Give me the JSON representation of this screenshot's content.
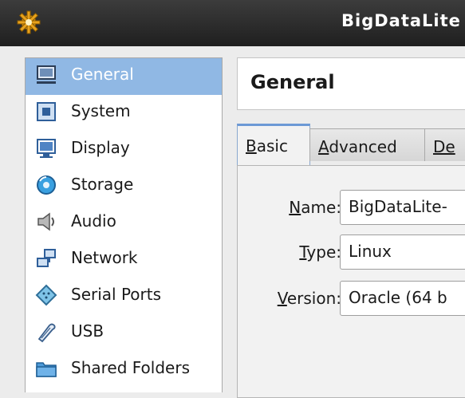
{
  "window": {
    "title": "BigDataLite"
  },
  "sidebar": {
    "items": [
      {
        "label": "General",
        "icon": "monitor-icon",
        "selected": true
      },
      {
        "label": "System",
        "icon": "chip-icon"
      },
      {
        "label": "Display",
        "icon": "display-icon"
      },
      {
        "label": "Storage",
        "icon": "disk-icon"
      },
      {
        "label": "Audio",
        "icon": "speaker-icon"
      },
      {
        "label": "Network",
        "icon": "network-icon"
      },
      {
        "label": "Serial Ports",
        "icon": "serial-port-icon"
      },
      {
        "label": "USB",
        "icon": "usb-icon"
      },
      {
        "label": "Shared Folders",
        "icon": "folder-icon"
      }
    ]
  },
  "header": {
    "title": "General"
  },
  "tabs": [
    {
      "mnemonic": "B",
      "rest": "asic"
    },
    {
      "mnemonic": "A",
      "rest": "dvanced"
    },
    {
      "mnemonic": "De",
      "rest": ""
    }
  ],
  "form": {
    "name": {
      "mnemonic": "N",
      "rest": "ame:",
      "value": "BigDataLite-"
    },
    "type": {
      "mnemonic": "T",
      "rest": "ype:",
      "value": "Linux"
    },
    "version": {
      "mnemonic": "V",
      "rest": "ersion:",
      "value": "Oracle (64 b"
    }
  },
  "colors": {
    "selection": "#90b8e4",
    "titlebar": "#2a2a2a"
  }
}
